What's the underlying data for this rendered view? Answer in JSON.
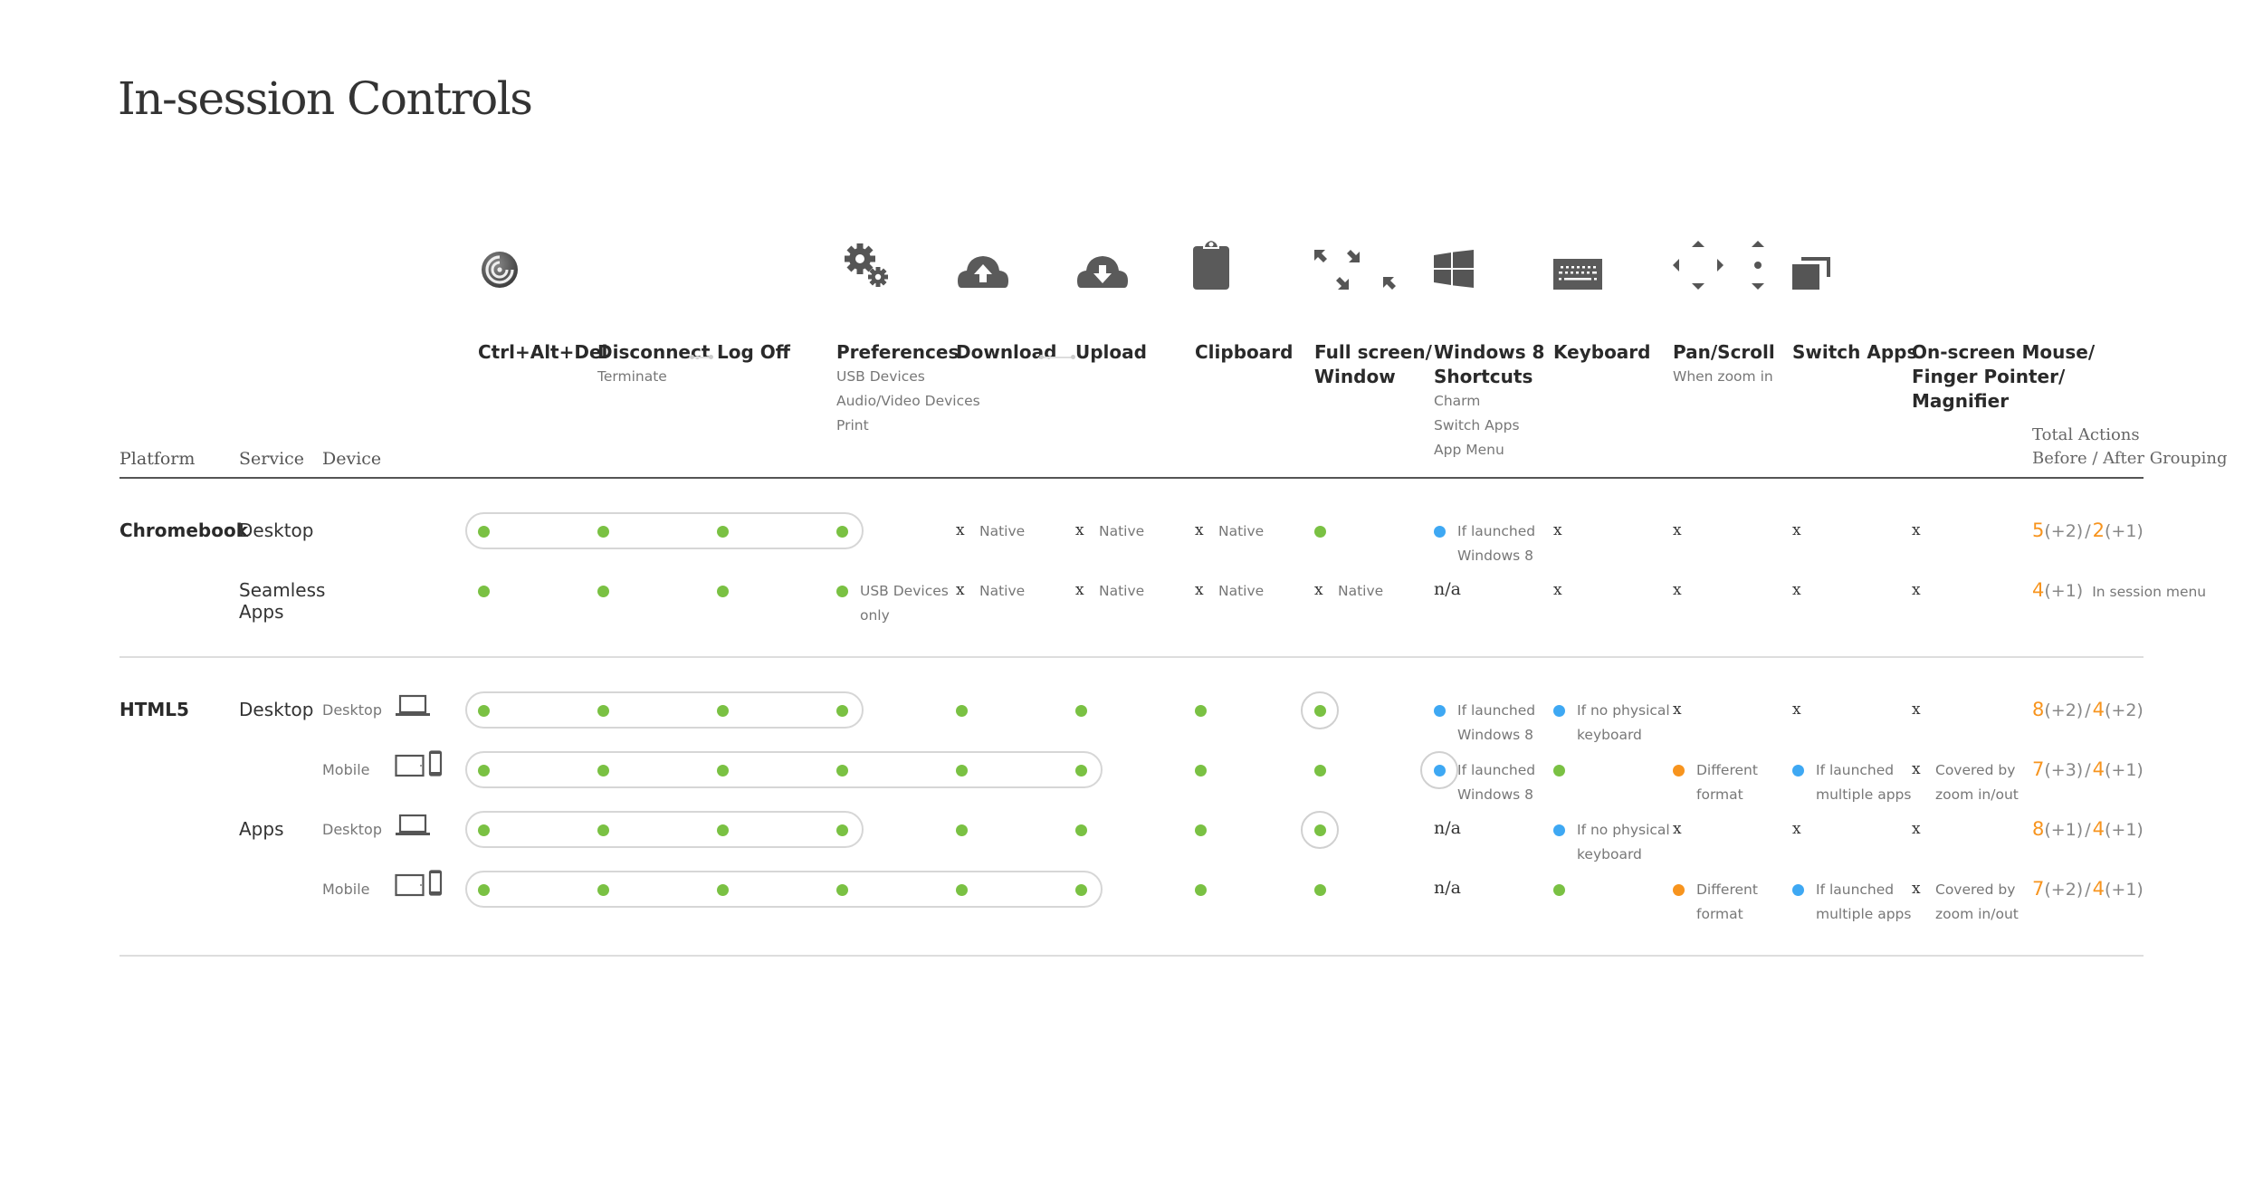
{
  "page": {
    "title": "In-session Controls"
  },
  "colors": {
    "supported": "#7ac143",
    "conditional": "#3ea8f3",
    "different": "#f7941e",
    "total_number": "#f7941e"
  },
  "columns": [
    {
      "key": "ctrl_alt_del",
      "label": "Ctrl+Alt+Del",
      "sub": [],
      "icon": "citrix-receiver-icon"
    },
    {
      "key": "disconnect",
      "label": "Disconnect",
      "sub": [
        "Terminate"
      ],
      "icon": ""
    },
    {
      "key": "log_off",
      "label": "Log Off",
      "sub": [],
      "icon": ""
    },
    {
      "key": "preferences",
      "label": "Preferences",
      "sub": [
        "USB Devices",
        "Audio/Video Devices",
        "Print"
      ],
      "icon": "gears-icon"
    },
    {
      "key": "download",
      "label": "Download",
      "sub": [],
      "icon": "cloud-upload-icon"
    },
    {
      "key": "upload",
      "label": "Upload",
      "sub": [],
      "icon": "cloud-download-icon"
    },
    {
      "key": "clipboard",
      "label": "Clipboard",
      "sub": [],
      "icon": "clipboard-icon"
    },
    {
      "key": "full_screen",
      "label": "Full screen/\nWindow",
      "label_lines": [
        "Full screen/",
        "Window"
      ],
      "sub": [],
      "icon": "fullscreen-arrows-icon"
    },
    {
      "key": "win8_shortcuts",
      "label_lines": [
        "Windows 8",
        "Shortcuts"
      ],
      "sub": [
        "Charm",
        "Switch Apps",
        "App Menu"
      ],
      "icon": "windows-logo-icon"
    },
    {
      "key": "keyboard",
      "label": "Keyboard",
      "sub": [],
      "icon": "keyboard-icon"
    },
    {
      "key": "pan_scroll",
      "label": "Pan/Scroll",
      "sub": [
        "When zoom in"
      ],
      "icon": "pan-scroll-arrows-icon"
    },
    {
      "key": "switch_apps",
      "label": "Switch Apps",
      "sub": [],
      "icon": "switch-windows-icon"
    },
    {
      "key": "onscreen_mouse",
      "label_lines": [
        "On-screen Mouse/",
        "Finger Pointer/",
        "Magnifier"
      ],
      "sub": [],
      "icon": ""
    }
  ],
  "row_headers": {
    "platform": "Platform",
    "service": "Service",
    "device": "Device",
    "total_lines": [
      "Total Actions",
      "Before / After Grouping"
    ]
  },
  "groups": [
    {
      "platform": "Chromebook",
      "rows": [
        {
          "service": "Desktop",
          "device": "",
          "device_icon": "",
          "cells": [
            {
              "t": "dot",
              "c": "green"
            },
            {
              "t": "dot",
              "c": "green"
            },
            {
              "t": "dot",
              "c": "green"
            },
            {
              "t": "dot",
              "c": "green"
            },
            {
              "t": "x",
              "note": [
                "Native"
              ]
            },
            {
              "t": "x",
              "note": [
                "Native"
              ]
            },
            {
              "t": "x",
              "note": [
                "Native"
              ]
            },
            {
              "t": "dot",
              "c": "green"
            },
            {
              "t": "dot",
              "c": "blue",
              "note": [
                "If launched",
                "Windows 8"
              ]
            },
            {
              "t": "x"
            },
            {
              "t": "x"
            },
            {
              "t": "x"
            },
            {
              "t": "x"
            }
          ],
          "grouped_span": [
            0,
            3
          ],
          "ringed": [],
          "total": {
            "before": "5",
            "before_extra": "(+2)",
            "after": "2",
            "after_extra": "(+1)",
            "note": ""
          }
        },
        {
          "service": "Seamless Apps",
          "device": "",
          "device_icon": "",
          "cells": [
            {
              "t": "dot",
              "c": "green"
            },
            {
              "t": "dot",
              "c": "green"
            },
            {
              "t": "dot",
              "c": "green"
            },
            {
              "t": "dot",
              "c": "green",
              "note": [
                "USB Devices",
                "only"
              ]
            },
            {
              "t": "x",
              "note": [
                "Native"
              ]
            },
            {
              "t": "x",
              "note": [
                "Native"
              ]
            },
            {
              "t": "x",
              "note": [
                "Native"
              ]
            },
            {
              "t": "x",
              "note": [
                "Native"
              ]
            },
            {
              "t": "na",
              "text": "n/a"
            },
            {
              "t": "x"
            },
            {
              "t": "x"
            },
            {
              "t": "x"
            },
            {
              "t": "x"
            }
          ],
          "grouped_span": null,
          "ringed": [],
          "total": {
            "before": "4",
            "before_extra": "(+1)",
            "after": "",
            "after_extra": "",
            "note": "In session menu"
          }
        }
      ]
    },
    {
      "platform": "HTML5",
      "rows": [
        {
          "service": "Desktop",
          "device": "Desktop",
          "device_icon": "laptop-icon",
          "cells": [
            {
              "t": "dot",
              "c": "green"
            },
            {
              "t": "dot",
              "c": "green"
            },
            {
              "t": "dot",
              "c": "green"
            },
            {
              "t": "dot",
              "c": "green"
            },
            {
              "t": "dot",
              "c": "green"
            },
            {
              "t": "dot",
              "c": "green"
            },
            {
              "t": "dot",
              "c": "green"
            },
            {
              "t": "dot",
              "c": "green"
            },
            {
              "t": "dot",
              "c": "blue",
              "note": [
                "If launched",
                "Windows 8"
              ]
            },
            {
              "t": "dot",
              "c": "blue",
              "note": [
                "If no physical",
                "keyboard"
              ]
            },
            {
              "t": "x"
            },
            {
              "t": "x"
            },
            {
              "t": "x"
            }
          ],
          "grouped_span": [
            0,
            3
          ],
          "ringed": [
            7
          ],
          "total": {
            "before": "8",
            "before_extra": "(+2)",
            "after": "4",
            "after_extra": "(+2)",
            "note": ""
          }
        },
        {
          "service": "",
          "device": "Mobile",
          "device_icon": "tablet-phone-icon",
          "cells": [
            {
              "t": "dot",
              "c": "green"
            },
            {
              "t": "dot",
              "c": "green"
            },
            {
              "t": "dot",
              "c": "green"
            },
            {
              "t": "dot",
              "c": "green"
            },
            {
              "t": "dot",
              "c": "green"
            },
            {
              "t": "dot",
              "c": "green"
            },
            {
              "t": "dot",
              "c": "green"
            },
            {
              "t": "dot",
              "c": "green"
            },
            {
              "t": "dot",
              "c": "blue",
              "note": [
                "If launched",
                "Windows 8"
              ]
            },
            {
              "t": "dot",
              "c": "green"
            },
            {
              "t": "dot",
              "c": "orange",
              "note": [
                "Different",
                "format"
              ]
            },
            {
              "t": "dot",
              "c": "blue",
              "note": [
                "If launched",
                "multiple apps"
              ]
            },
            {
              "t": "x",
              "note": [
                "Covered by",
                "zoom in/out"
              ]
            }
          ],
          "grouped_span": [
            0,
            5
          ],
          "ringed": [
            8
          ],
          "total": {
            "before": "7",
            "before_extra": "(+3)",
            "after": "4",
            "after_extra": "(+1)",
            "note": ""
          }
        },
        {
          "service": "Apps",
          "device": "Desktop",
          "device_icon": "laptop-icon",
          "cells": [
            {
              "t": "dot",
              "c": "green"
            },
            {
              "t": "dot",
              "c": "green"
            },
            {
              "t": "dot",
              "c": "green"
            },
            {
              "t": "dot",
              "c": "green"
            },
            {
              "t": "dot",
              "c": "green"
            },
            {
              "t": "dot",
              "c": "green"
            },
            {
              "t": "dot",
              "c": "green"
            },
            {
              "t": "dot",
              "c": "green"
            },
            {
              "t": "na",
              "text": "n/a"
            },
            {
              "t": "dot",
              "c": "blue",
              "note": [
                "If no physical",
                "keyboard"
              ]
            },
            {
              "t": "x"
            },
            {
              "t": "x"
            },
            {
              "t": "x"
            }
          ],
          "grouped_span": [
            0,
            3
          ],
          "ringed": [
            7
          ],
          "total": {
            "before": "8",
            "before_extra": "(+1)",
            "after": "4",
            "after_extra": "(+1)",
            "note": ""
          }
        },
        {
          "service": "",
          "device": "Mobile",
          "device_icon": "tablet-phone-icon",
          "cells": [
            {
              "t": "dot",
              "c": "green"
            },
            {
              "t": "dot",
              "c": "green"
            },
            {
              "t": "dot",
              "c": "green"
            },
            {
              "t": "dot",
              "c": "green"
            },
            {
              "t": "dot",
              "c": "green"
            },
            {
              "t": "dot",
              "c": "green"
            },
            {
              "t": "dot",
              "c": "green"
            },
            {
              "t": "dot",
              "c": "green"
            },
            {
              "t": "na",
              "text": "n/a"
            },
            {
              "t": "dot",
              "c": "green"
            },
            {
              "t": "dot",
              "c": "orange",
              "note": [
                "Different",
                "format"
              ]
            },
            {
              "t": "dot",
              "c": "blue",
              "note": [
                "If launched",
                "multiple apps"
              ]
            },
            {
              "t": "x",
              "note": [
                "Covered by",
                "zoom in/out"
              ]
            }
          ],
          "grouped_span": [
            0,
            5
          ],
          "ringed": [],
          "total": {
            "before": "7",
            "before_extra": "(+2)",
            "after": "4",
            "after_extra": "(+1)",
            "note": ""
          }
        }
      ]
    }
  ]
}
